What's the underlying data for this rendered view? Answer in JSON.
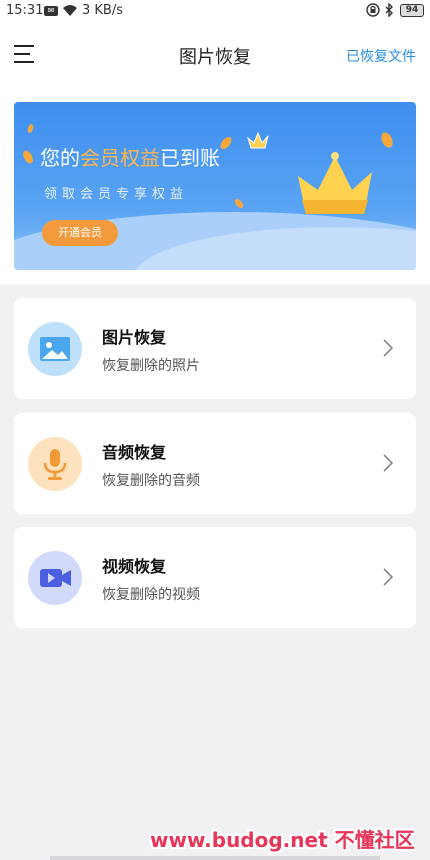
{
  "status_bar": {
    "time": "15:31",
    "network_speed": "3 KB/s",
    "battery": "94"
  },
  "header": {
    "title": "图片恢复",
    "restored_files_label": "已恢复文件"
  },
  "banner": {
    "headline_part1": "您的",
    "headline_highlight": "会员权益",
    "headline_part2": "已到账",
    "subtitle": "领取会员专享权益",
    "button_label": "开通会员"
  },
  "cards": [
    {
      "title": "图片恢复",
      "description": "恢复删除的照片",
      "icon": "image-icon",
      "icon_bg": "#bfe0fb",
      "icon_color": "#4aa6ef"
    },
    {
      "title": "音频恢复",
      "description": "恢复删除的音频",
      "icon": "microphone-icon",
      "icon_bg": "#fde2bd",
      "icon_color": "#f19a38"
    },
    {
      "title": "视频恢复",
      "description": "恢复删除的视频",
      "icon": "video-camera-icon",
      "icon_bg": "#d3d9fb",
      "icon_color": "#4b5fe0"
    }
  ],
  "watermark": "www.budog.net 不懂社区",
  "colors": {
    "accent_blue": "#2a8fe0",
    "banner_blue": "#3d8ef0",
    "vip_orange": "#f39b3c",
    "highlight_gold": "#ffb64d"
  }
}
